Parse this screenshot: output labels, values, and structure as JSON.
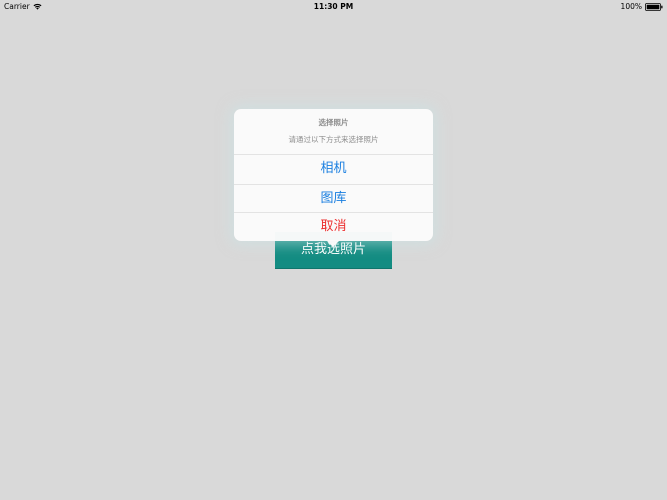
{
  "status_bar": {
    "carrier": "Carrier",
    "time": "11:30 PM",
    "battery": "100%"
  },
  "main": {
    "pick_button_label": "点我选照片"
  },
  "popover": {
    "title": "选择照片",
    "message": "请通过以下方式来选择照片",
    "actions": [
      {
        "label": "相机",
        "style": "default"
      },
      {
        "label": "图库",
        "style": "default"
      },
      {
        "label": "取消",
        "style": "destructive"
      }
    ]
  },
  "colors": {
    "background": "#d9d9d9",
    "button": "#138c82",
    "action_blue": "#1a7fe0",
    "action_red": "#ec2f2f"
  }
}
